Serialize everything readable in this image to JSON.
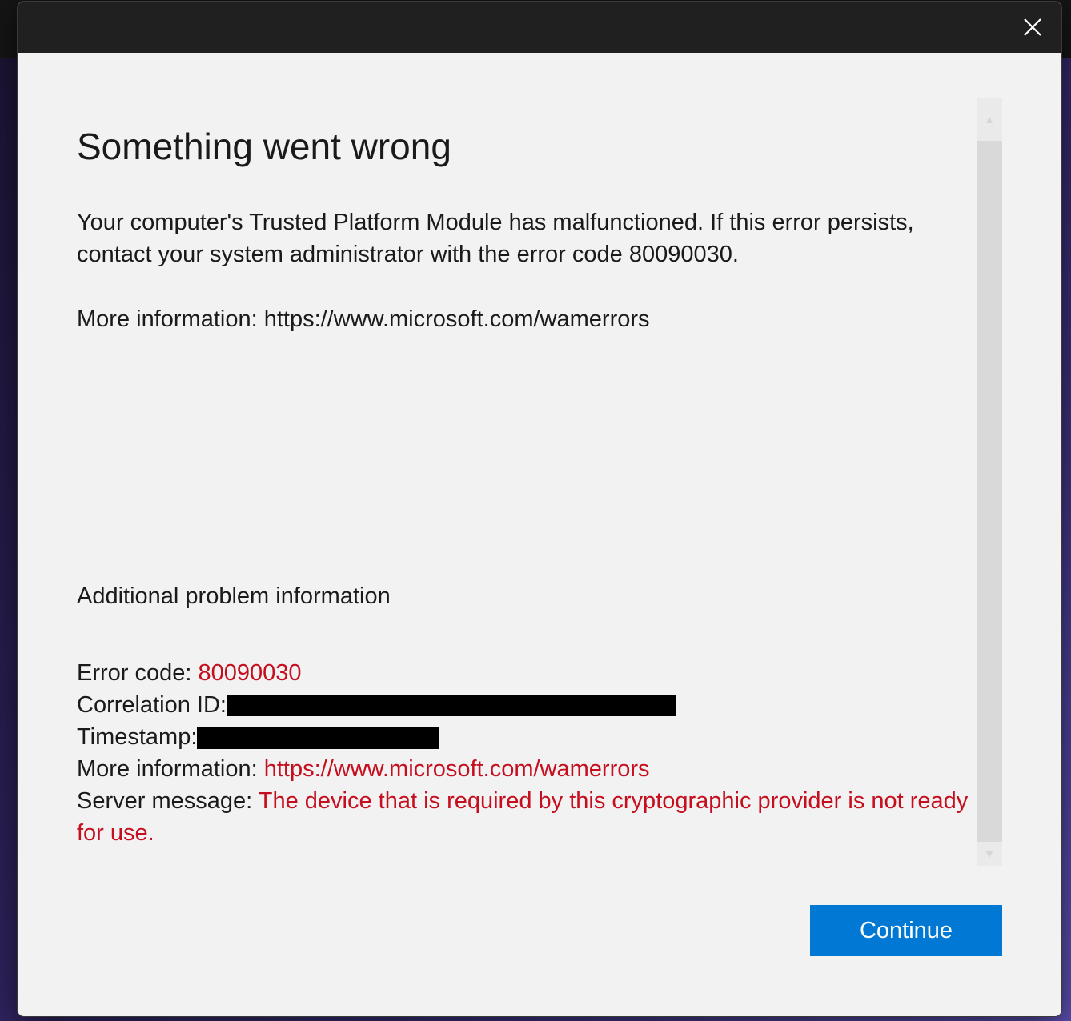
{
  "dialog": {
    "title": "Something went wrong",
    "message": "Your computer's Trusted Platform Module has malfunctioned. If this error persists, contact your system administrator with the error code 80090030.",
    "more_info_line": "More information: https://www.microsoft.com/wamerrors",
    "additional_heading": "Additional problem information",
    "details": {
      "error_code_label": "Error code: ",
      "error_code_value": "80090030",
      "correlation_label": "Correlation ID:",
      "timestamp_label": "Timestamp:",
      "more_info_label": "More information: ",
      "more_info_value": "https://www.microsoft.com/wamerrors",
      "server_message_label": "Server message: ",
      "server_message_value": "The device that is required by this cryptographic provider is not ready for use."
    },
    "continue_label": "Continue",
    "close_icon": "close-icon"
  },
  "colors": {
    "accent": "#0078d4",
    "error_text": "#c50f1f",
    "titlebar": "#202020",
    "dialog_bg": "#f2f2f2"
  }
}
